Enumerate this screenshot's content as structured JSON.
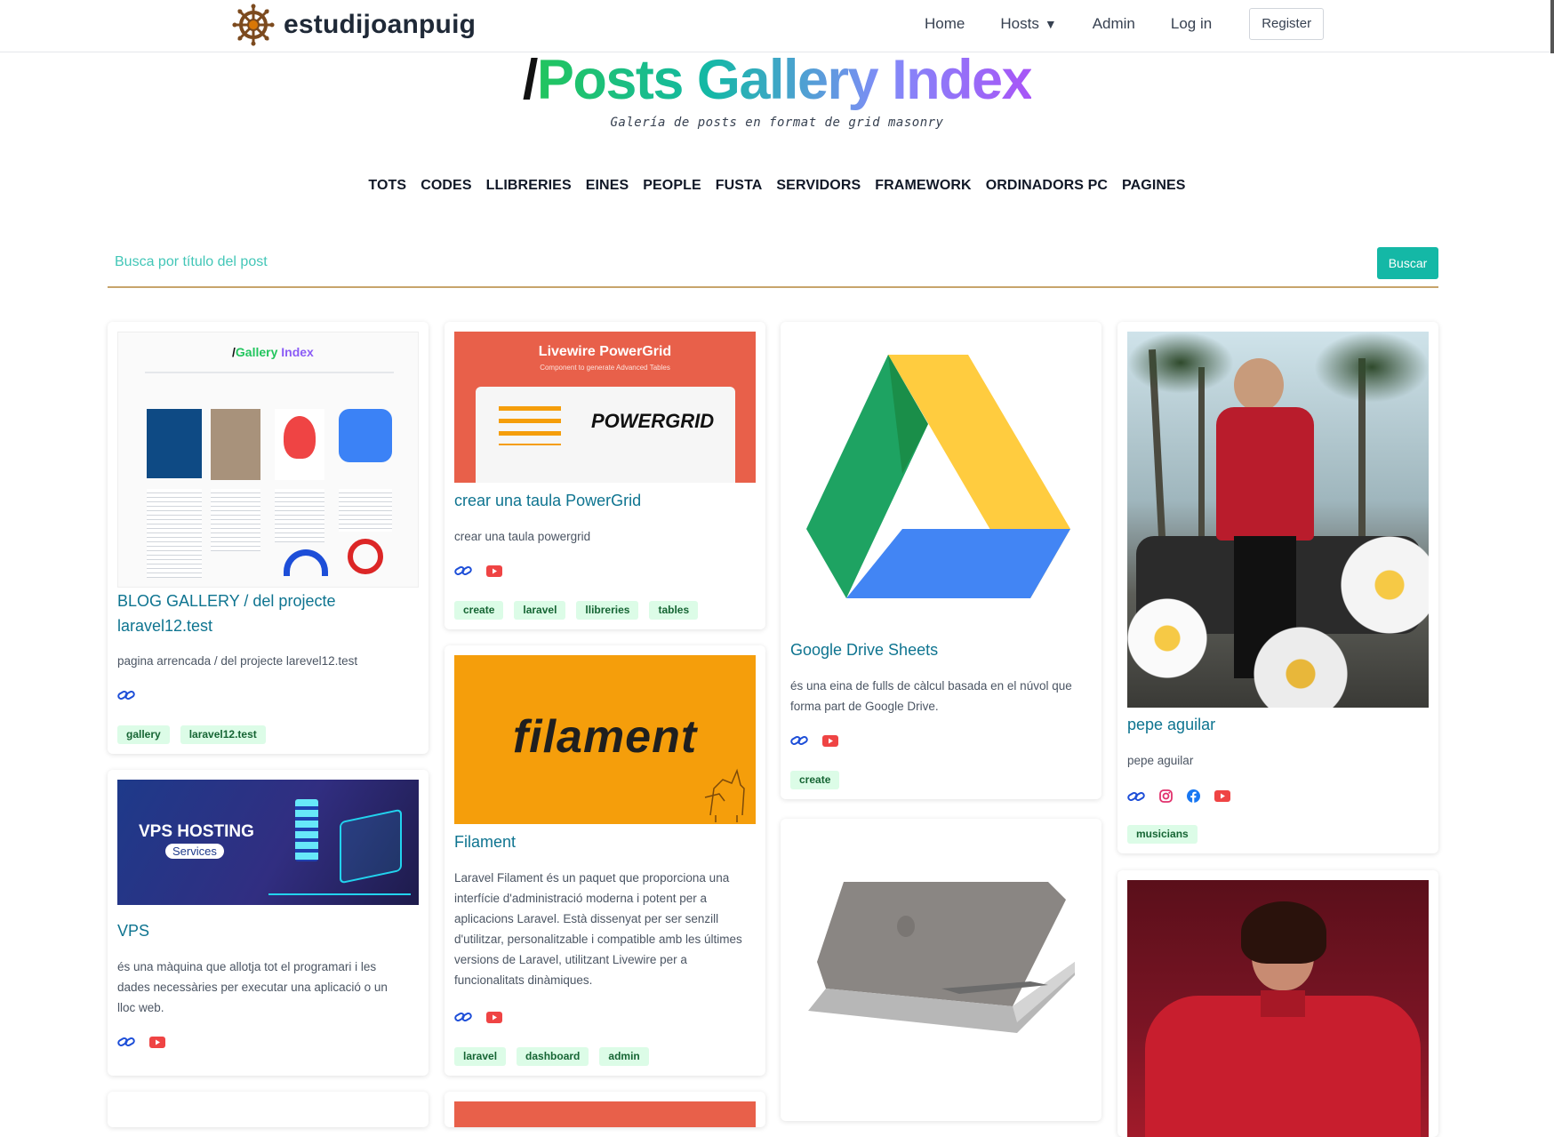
{
  "brand": {
    "name": "estudijoanpuig"
  },
  "topnav": {
    "home": "Home",
    "hosts": "Hosts",
    "hosts_arrow": "▼",
    "admin": "Admin",
    "login": "Log in",
    "register": "Register"
  },
  "hero": {
    "slash": "/",
    "title": "Posts Gallery Index",
    "subtitle": "Galería de posts en format de grid masonry"
  },
  "categories": [
    "TOTS",
    "CODES",
    "LLIBRERIES",
    "EINES",
    "PEOPLE",
    "FUSTA",
    "SERVIDORS",
    "FRAMEWORK",
    "ORDINADORS PC",
    "PAGINES"
  ],
  "search": {
    "placeholder": "Busca por título del post",
    "button": "Buscar"
  },
  "cards": [
    {
      "title": "BLOG GALLERY / del projecte laravel12.test",
      "description": "pagina arrencada / del projecte larevel12.test",
      "tags": [
        "gallery",
        "laravel12.test"
      ]
    },
    {
      "title": "crear una taula PowerGrid",
      "description": "crear una taula powergrid",
      "tags": [
        "create",
        "laravel",
        "llibreries",
        "tables"
      ],
      "image_text": "Livewire PowerGrid",
      "image_subtext": "Component to generate Advanced Tables",
      "image_logo": "POWERGRID"
    },
    {
      "title": "Google Drive Sheets",
      "description": "és una eina de fulls de càlcul basada en el núvol que forma part de Google Drive.",
      "tags": [
        "create"
      ]
    },
    {
      "title": "pepe aguilar",
      "description": "pepe aguilar",
      "tags": [
        "musicians"
      ]
    },
    {
      "title": "VPS",
      "description": "és una màquina que allotja tot el programari i les dades necessàries per executar una aplicació o un lloc web.",
      "tags": [],
      "image_text": "VPS HOSTING",
      "image_subtext": "Services"
    },
    {
      "title": "Filament",
      "description": "Laravel Filament és un paquet que proporciona una interfície d'administració moderna i potent per a aplicacions Laravel. Està dissenyat per ser senzill d'utilitzar, personalitzable i compatible amb les últimes versions de Laravel, utilitzant Livewire per a funcionalitats dinàmiques.",
      "tags": [
        "laravel",
        "dashboard",
        "admin"
      ],
      "image_text": "filament"
    }
  ],
  "colors": {
    "accent": "#14b8a6",
    "title": "#0e7490",
    "tag_bg": "#dcfce7",
    "tag_fg": "#166534",
    "youtube": "#ef4444",
    "link": "#1d4ed8"
  }
}
